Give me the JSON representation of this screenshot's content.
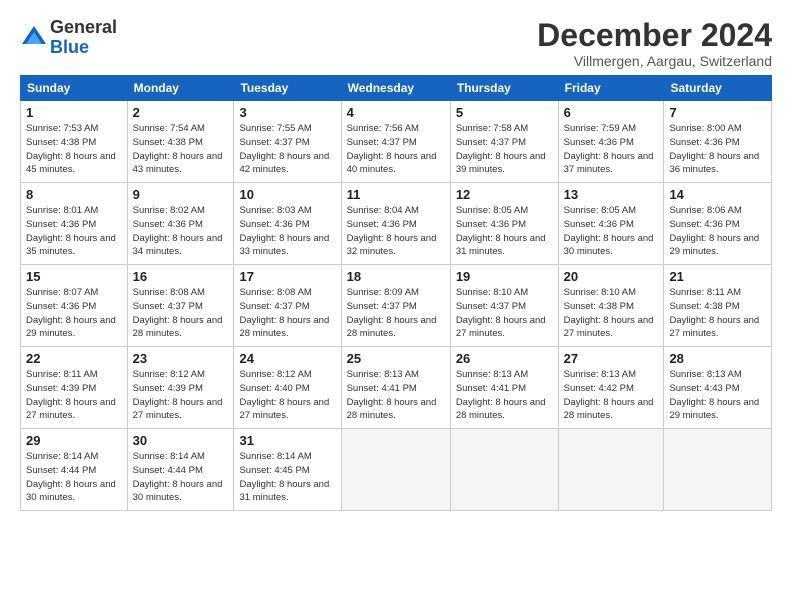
{
  "header": {
    "logo_general": "General",
    "logo_blue": "Blue",
    "month_title": "December 2024",
    "subtitle": "Villmergen, Aargau, Switzerland"
  },
  "weekdays": [
    "Sunday",
    "Monday",
    "Tuesday",
    "Wednesday",
    "Thursday",
    "Friday",
    "Saturday"
  ],
  "weeks": [
    [
      {
        "day": "1",
        "sunrise": "Sunrise: 7:53 AM",
        "sunset": "Sunset: 4:38 PM",
        "daylight": "Daylight: 8 hours and 45 minutes."
      },
      {
        "day": "2",
        "sunrise": "Sunrise: 7:54 AM",
        "sunset": "Sunset: 4:38 PM",
        "daylight": "Daylight: 8 hours and 43 minutes."
      },
      {
        "day": "3",
        "sunrise": "Sunrise: 7:55 AM",
        "sunset": "Sunset: 4:37 PM",
        "daylight": "Daylight: 8 hours and 42 minutes."
      },
      {
        "day": "4",
        "sunrise": "Sunrise: 7:56 AM",
        "sunset": "Sunset: 4:37 PM",
        "daylight": "Daylight: 8 hours and 40 minutes."
      },
      {
        "day": "5",
        "sunrise": "Sunrise: 7:58 AM",
        "sunset": "Sunset: 4:37 PM",
        "daylight": "Daylight: 8 hours and 39 minutes."
      },
      {
        "day": "6",
        "sunrise": "Sunrise: 7:59 AM",
        "sunset": "Sunset: 4:36 PM",
        "daylight": "Daylight: 8 hours and 37 minutes."
      },
      {
        "day": "7",
        "sunrise": "Sunrise: 8:00 AM",
        "sunset": "Sunset: 4:36 PM",
        "daylight": "Daylight: 8 hours and 36 minutes."
      }
    ],
    [
      {
        "day": "8",
        "sunrise": "Sunrise: 8:01 AM",
        "sunset": "Sunset: 4:36 PM",
        "daylight": "Daylight: 8 hours and 35 minutes."
      },
      {
        "day": "9",
        "sunrise": "Sunrise: 8:02 AM",
        "sunset": "Sunset: 4:36 PM",
        "daylight": "Daylight: 8 hours and 34 minutes."
      },
      {
        "day": "10",
        "sunrise": "Sunrise: 8:03 AM",
        "sunset": "Sunset: 4:36 PM",
        "daylight": "Daylight: 8 hours and 33 minutes."
      },
      {
        "day": "11",
        "sunrise": "Sunrise: 8:04 AM",
        "sunset": "Sunset: 4:36 PM",
        "daylight": "Daylight: 8 hours and 32 minutes."
      },
      {
        "day": "12",
        "sunrise": "Sunrise: 8:05 AM",
        "sunset": "Sunset: 4:36 PM",
        "daylight": "Daylight: 8 hours and 31 minutes."
      },
      {
        "day": "13",
        "sunrise": "Sunrise: 8:05 AM",
        "sunset": "Sunset: 4:36 PM",
        "daylight": "Daylight: 8 hours and 30 minutes."
      },
      {
        "day": "14",
        "sunrise": "Sunrise: 8:06 AM",
        "sunset": "Sunset: 4:36 PM",
        "daylight": "Daylight: 8 hours and 29 minutes."
      }
    ],
    [
      {
        "day": "15",
        "sunrise": "Sunrise: 8:07 AM",
        "sunset": "Sunset: 4:36 PM",
        "daylight": "Daylight: 8 hours and 29 minutes."
      },
      {
        "day": "16",
        "sunrise": "Sunrise: 8:08 AM",
        "sunset": "Sunset: 4:37 PM",
        "daylight": "Daylight: 8 hours and 28 minutes."
      },
      {
        "day": "17",
        "sunrise": "Sunrise: 8:08 AM",
        "sunset": "Sunset: 4:37 PM",
        "daylight": "Daylight: 8 hours and 28 minutes."
      },
      {
        "day": "18",
        "sunrise": "Sunrise: 8:09 AM",
        "sunset": "Sunset: 4:37 PM",
        "daylight": "Daylight: 8 hours and 28 minutes."
      },
      {
        "day": "19",
        "sunrise": "Sunrise: 8:10 AM",
        "sunset": "Sunset: 4:37 PM",
        "daylight": "Daylight: 8 hours and 27 minutes."
      },
      {
        "day": "20",
        "sunrise": "Sunrise: 8:10 AM",
        "sunset": "Sunset: 4:38 PM",
        "daylight": "Daylight: 8 hours and 27 minutes."
      },
      {
        "day": "21",
        "sunrise": "Sunrise: 8:11 AM",
        "sunset": "Sunset: 4:38 PM",
        "daylight": "Daylight: 8 hours and 27 minutes."
      }
    ],
    [
      {
        "day": "22",
        "sunrise": "Sunrise: 8:11 AM",
        "sunset": "Sunset: 4:39 PM",
        "daylight": "Daylight: 8 hours and 27 minutes."
      },
      {
        "day": "23",
        "sunrise": "Sunrise: 8:12 AM",
        "sunset": "Sunset: 4:39 PM",
        "daylight": "Daylight: 8 hours and 27 minutes."
      },
      {
        "day": "24",
        "sunrise": "Sunrise: 8:12 AM",
        "sunset": "Sunset: 4:40 PM",
        "daylight": "Daylight: 8 hours and 27 minutes."
      },
      {
        "day": "25",
        "sunrise": "Sunrise: 8:13 AM",
        "sunset": "Sunset: 4:41 PM",
        "daylight": "Daylight: 8 hours and 28 minutes."
      },
      {
        "day": "26",
        "sunrise": "Sunrise: 8:13 AM",
        "sunset": "Sunset: 4:41 PM",
        "daylight": "Daylight: 8 hours and 28 minutes."
      },
      {
        "day": "27",
        "sunrise": "Sunrise: 8:13 AM",
        "sunset": "Sunset: 4:42 PM",
        "daylight": "Daylight: 8 hours and 28 minutes."
      },
      {
        "day": "28",
        "sunrise": "Sunrise: 8:13 AM",
        "sunset": "Sunset: 4:43 PM",
        "daylight": "Daylight: 8 hours and 29 minutes."
      }
    ],
    [
      {
        "day": "29",
        "sunrise": "Sunrise: 8:14 AM",
        "sunset": "Sunset: 4:44 PM",
        "daylight": "Daylight: 8 hours and 30 minutes."
      },
      {
        "day": "30",
        "sunrise": "Sunrise: 8:14 AM",
        "sunset": "Sunset: 4:44 PM",
        "daylight": "Daylight: 8 hours and 30 minutes."
      },
      {
        "day": "31",
        "sunrise": "Sunrise: 8:14 AM",
        "sunset": "Sunset: 4:45 PM",
        "daylight": "Daylight: 8 hours and 31 minutes."
      },
      null,
      null,
      null,
      null
    ]
  ]
}
